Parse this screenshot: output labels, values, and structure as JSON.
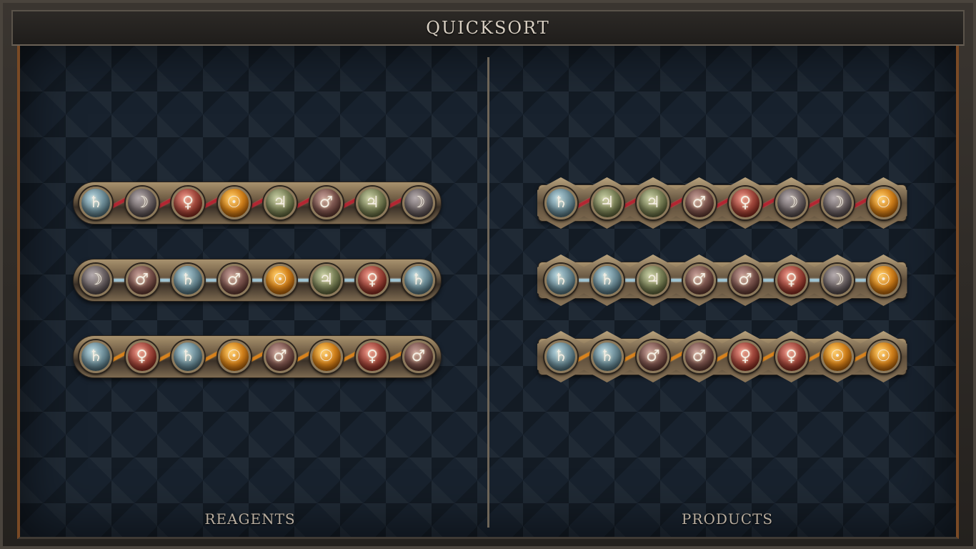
{
  "title": "QUICKSORT",
  "panels": {
    "left_label": "REAGENTS",
    "right_label": "PRODUCTS"
  },
  "elements": {
    "saturn": {
      "glyph": "♄",
      "color": "#6f8f9a"
    },
    "moon": {
      "glyph": "☽",
      "color": "#6f6668"
    },
    "venus": {
      "glyph": "♀",
      "color": "#a44a3e"
    },
    "sun": {
      "glyph": "☉",
      "color": "#d6841c"
    },
    "jupiter": {
      "glyph": "♃",
      "color": "#7d845a"
    },
    "mars": {
      "glyph": "♂",
      "color": "#7e5750"
    }
  },
  "link_colors": {
    "red": "#b32632",
    "blue": "#9fc3d1",
    "orange": "#d9821c"
  },
  "reagents": [
    {
      "link": "red",
      "items": [
        "saturn",
        "moon",
        "venus",
        "sun",
        "jupiter",
        "mars",
        "jupiter",
        "moon"
      ]
    },
    {
      "link": "blue",
      "items": [
        "moon",
        "mars",
        "saturn",
        "mars",
        "sun",
        "jupiter",
        "venus",
        "saturn"
      ]
    },
    {
      "link": "orange",
      "items": [
        "saturn",
        "venus",
        "saturn",
        "sun",
        "mars",
        "sun",
        "venus",
        "mars"
      ]
    }
  ],
  "products": [
    {
      "link": "red",
      "items": [
        "saturn",
        "jupiter",
        "jupiter",
        "mars",
        "venus",
        "moon",
        "moon",
        "sun"
      ]
    },
    {
      "link": "blue",
      "items": [
        "saturn",
        "saturn",
        "jupiter",
        "mars",
        "mars",
        "venus",
        "moon",
        "sun"
      ]
    },
    {
      "link": "orange",
      "items": [
        "saturn",
        "saturn",
        "mars",
        "mars",
        "venus",
        "venus",
        "sun",
        "sun"
      ]
    }
  ]
}
